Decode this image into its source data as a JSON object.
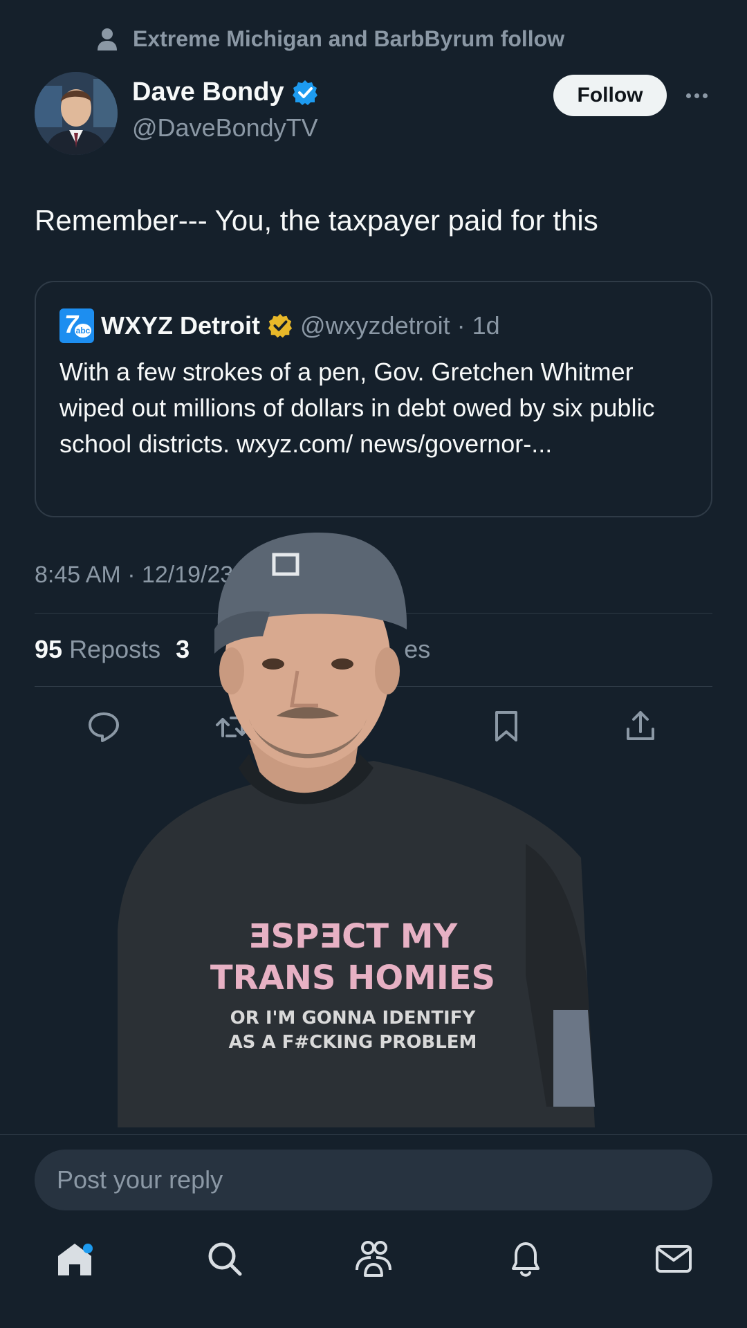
{
  "social_context": {
    "text": "Extreme Michigan and BarbByrum follow",
    "icon": "person-icon"
  },
  "author": {
    "name": "Dave Bondy",
    "handle": "@DaveBondyTV",
    "verified_color": "#1d9bf0",
    "follow_label": "Follow"
  },
  "tweet": {
    "text": "Remember--- You, the taxpayer paid for this"
  },
  "quote": {
    "name": "WXYZ Detroit",
    "handle": "@wxyzdetroit",
    "separator": "·",
    "age": "1d",
    "verified_color": "#e8b829",
    "text": "With a few strokes of a pen, Gov. Gretchen Whitmer wiped out millions of dollars in debt owed by six public school districts. wxyz.com/ news/governor-..."
  },
  "timestamp": "8:45 AM · 12/19/23",
  "stats": {
    "reposts_count": "95",
    "reposts_label": "Reposts",
    "second_count": "3",
    "second_label": "es"
  },
  "actions": [
    "reply-icon",
    "repost-icon",
    "bookmark-icon",
    "share-icon"
  ],
  "composer": {
    "placeholder": "Post your reply"
  },
  "nav": [
    "home-icon",
    "search-icon",
    "communities-icon",
    "notifications-icon",
    "messages-icon"
  ],
  "colors": {
    "background": "#15202b",
    "accent": "#1d9bf0",
    "muted": "#8b98a5",
    "border": "#2f3b47"
  }
}
